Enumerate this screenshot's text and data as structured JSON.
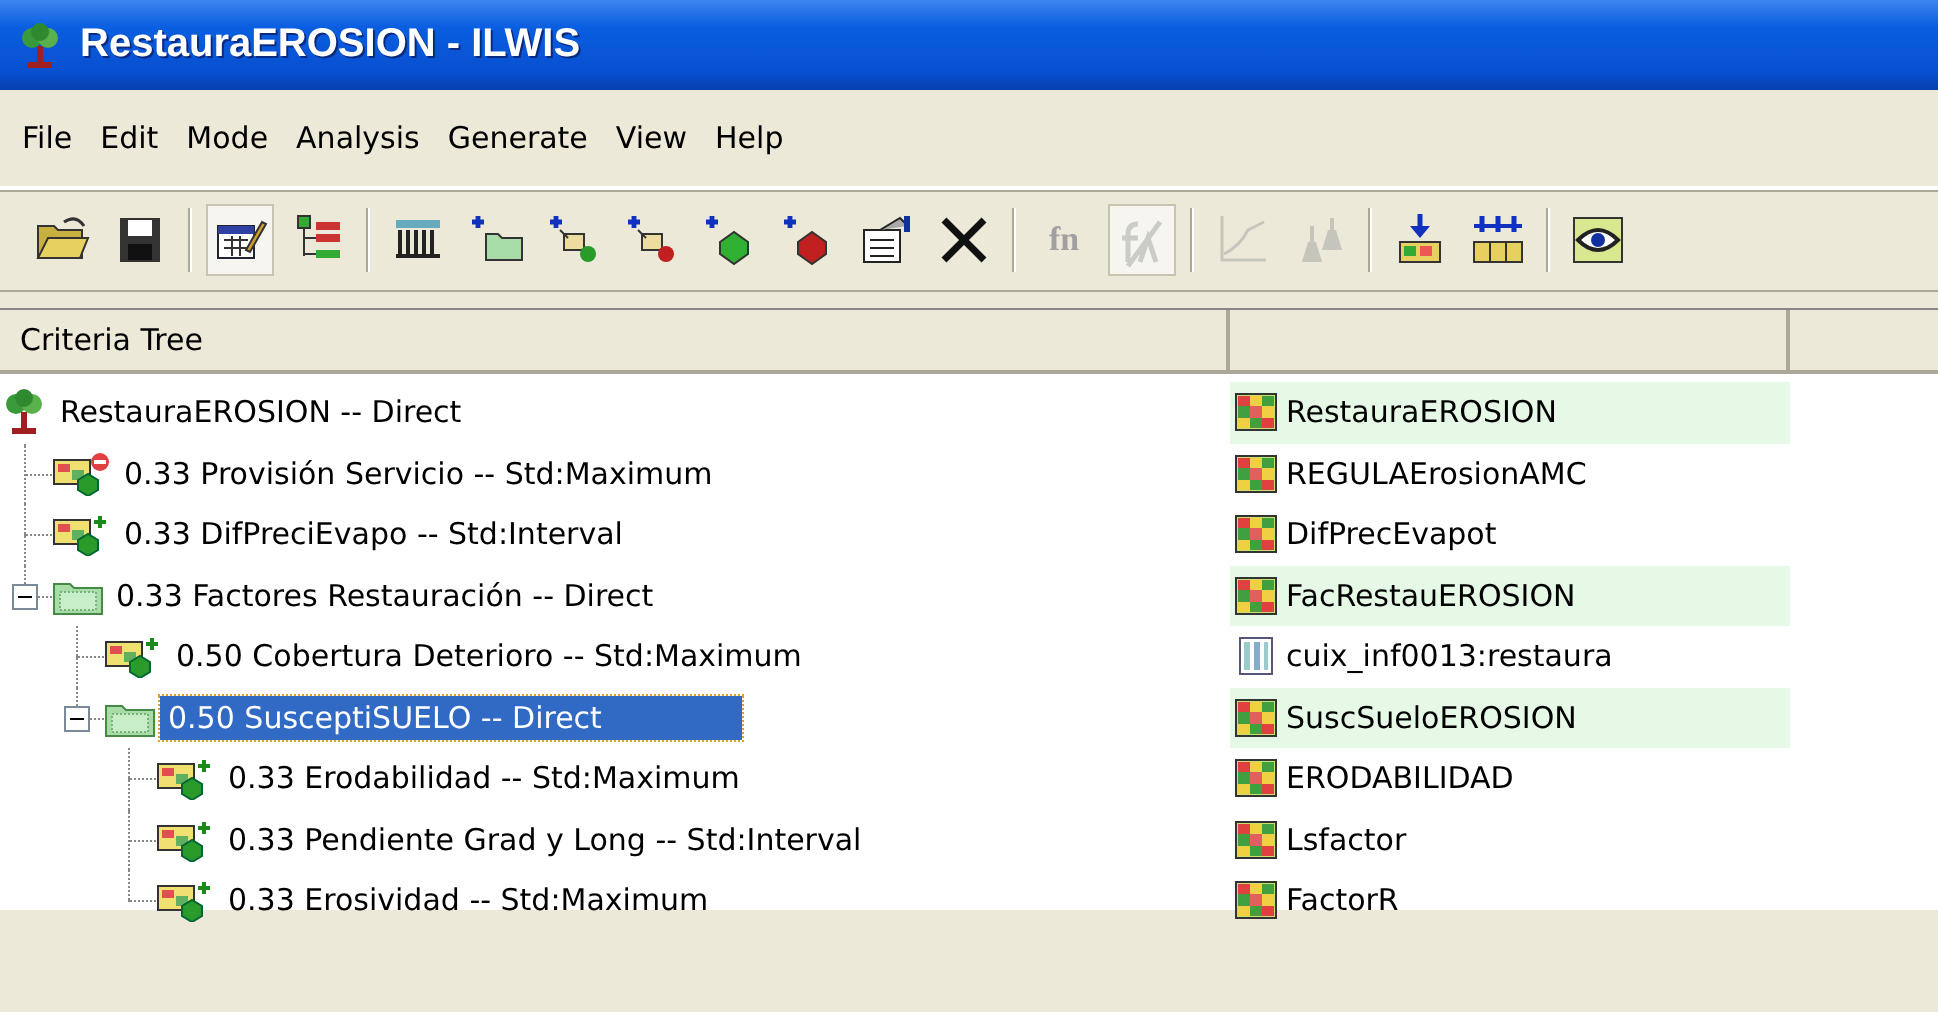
{
  "window": {
    "title": "RestauraEROSION - ILWIS"
  },
  "menu": [
    "File",
    "Edit",
    "Mode",
    "Analysis",
    "Generate",
    "View",
    "Help"
  ],
  "toolbar": [
    {
      "kind": "open",
      "disabled": false,
      "pressed": false
    },
    {
      "kind": "save",
      "disabled": false,
      "pressed": false
    },
    {
      "kind": "separator"
    },
    {
      "kind": "edit-mode",
      "disabled": false,
      "pressed": true
    },
    {
      "kind": "tree-mode",
      "disabled": false,
      "pressed": false
    },
    {
      "kind": "separator"
    },
    {
      "kind": "table",
      "disabled": false,
      "pressed": false
    },
    {
      "kind": "add-group",
      "disabled": false,
      "pressed": false
    },
    {
      "kind": "add-benefit",
      "disabled": false,
      "pressed": false
    },
    {
      "kind": "add-cost",
      "disabled": false,
      "pressed": false
    },
    {
      "kind": "add-green",
      "disabled": false,
      "pressed": false
    },
    {
      "kind": "add-red",
      "disabled": false,
      "pressed": false
    },
    {
      "kind": "properties",
      "disabled": false,
      "pressed": false
    },
    {
      "kind": "delete",
      "disabled": false,
      "pressed": false
    },
    {
      "kind": "separator"
    },
    {
      "kind": "fn",
      "label": "fn",
      "disabled": true,
      "pressed": false
    },
    {
      "kind": "fn-multi",
      "disabled": true,
      "pressed": true
    },
    {
      "kind": "separator"
    },
    {
      "kind": "graph",
      "disabled": true,
      "pressed": false
    },
    {
      "kind": "weights",
      "disabled": true,
      "pressed": false
    },
    {
      "kind": "separator"
    },
    {
      "kind": "load-map",
      "disabled": false,
      "pressed": false
    },
    {
      "kind": "load-maps",
      "disabled": false,
      "pressed": false
    },
    {
      "kind": "separator"
    },
    {
      "kind": "show",
      "disabled": false,
      "pressed": false
    }
  ],
  "columns": [
    "Criteria Tree"
  ],
  "tree": [
    {
      "kind": "root",
      "label": "RestauraEROSION -- Direct",
      "selected": false,
      "output": {
        "kind": "map",
        "name": "RestauraEROSION",
        "highlighted": true
      },
      "children": [
        {
          "kind": "cost",
          "label": "0.33 Provisión Servicio -- Std:Maximum",
          "selected": false,
          "output": {
            "kind": "map",
            "name": "REGULAErosionAMC",
            "highlighted": false
          }
        },
        {
          "kind": "benefit",
          "label": "0.33 DifPreciEvapo -- Std:Interval",
          "selected": false,
          "output": {
            "kind": "map",
            "name": "DifPrecEvapot",
            "highlighted": false
          }
        },
        {
          "kind": "group",
          "label": "0.33 Factores Restauración -- Direct",
          "selected": false,
          "expanded": true,
          "output": {
            "kind": "map",
            "name": "FacRestauEROSION",
            "highlighted": true
          },
          "children": [
            {
              "kind": "benefit",
              "label": "0.50 Cobertura Deterioro -- Std:Maximum",
              "selected": false,
              "output": {
                "kind": "table",
                "name": "cuix_inf0013:restaura",
                "highlighted": false
              }
            },
            {
              "kind": "group",
              "label": "0.50 SusceptiSUELO -- Direct",
              "selected": true,
              "expanded": true,
              "output": {
                "kind": "map",
                "name": "SuscSueloEROSION",
                "highlighted": true
              },
              "children": [
                {
                  "kind": "benefit",
                  "label": "0.33 Erodabilidad -- Std:Maximum",
                  "selected": false,
                  "output": {
                    "kind": "map",
                    "name": "ERODABILIDAD",
                    "highlighted": false
                  }
                },
                {
                  "kind": "benefit",
                  "label": "0.33 Pendiente Grad y Long -- Std:Interval",
                  "selected": false,
                  "output": {
                    "kind": "map",
                    "name": "Lsfactor",
                    "highlighted": false
                  }
                },
                {
                  "kind": "benefit",
                  "label": "0.33 Erosividad -- Std:Maximum",
                  "selected": false,
                  "output": {
                    "kind": "map",
                    "name": "FactorR",
                    "highlighted": false
                  }
                }
              ]
            }
          ]
        }
      ]
    }
  ]
}
